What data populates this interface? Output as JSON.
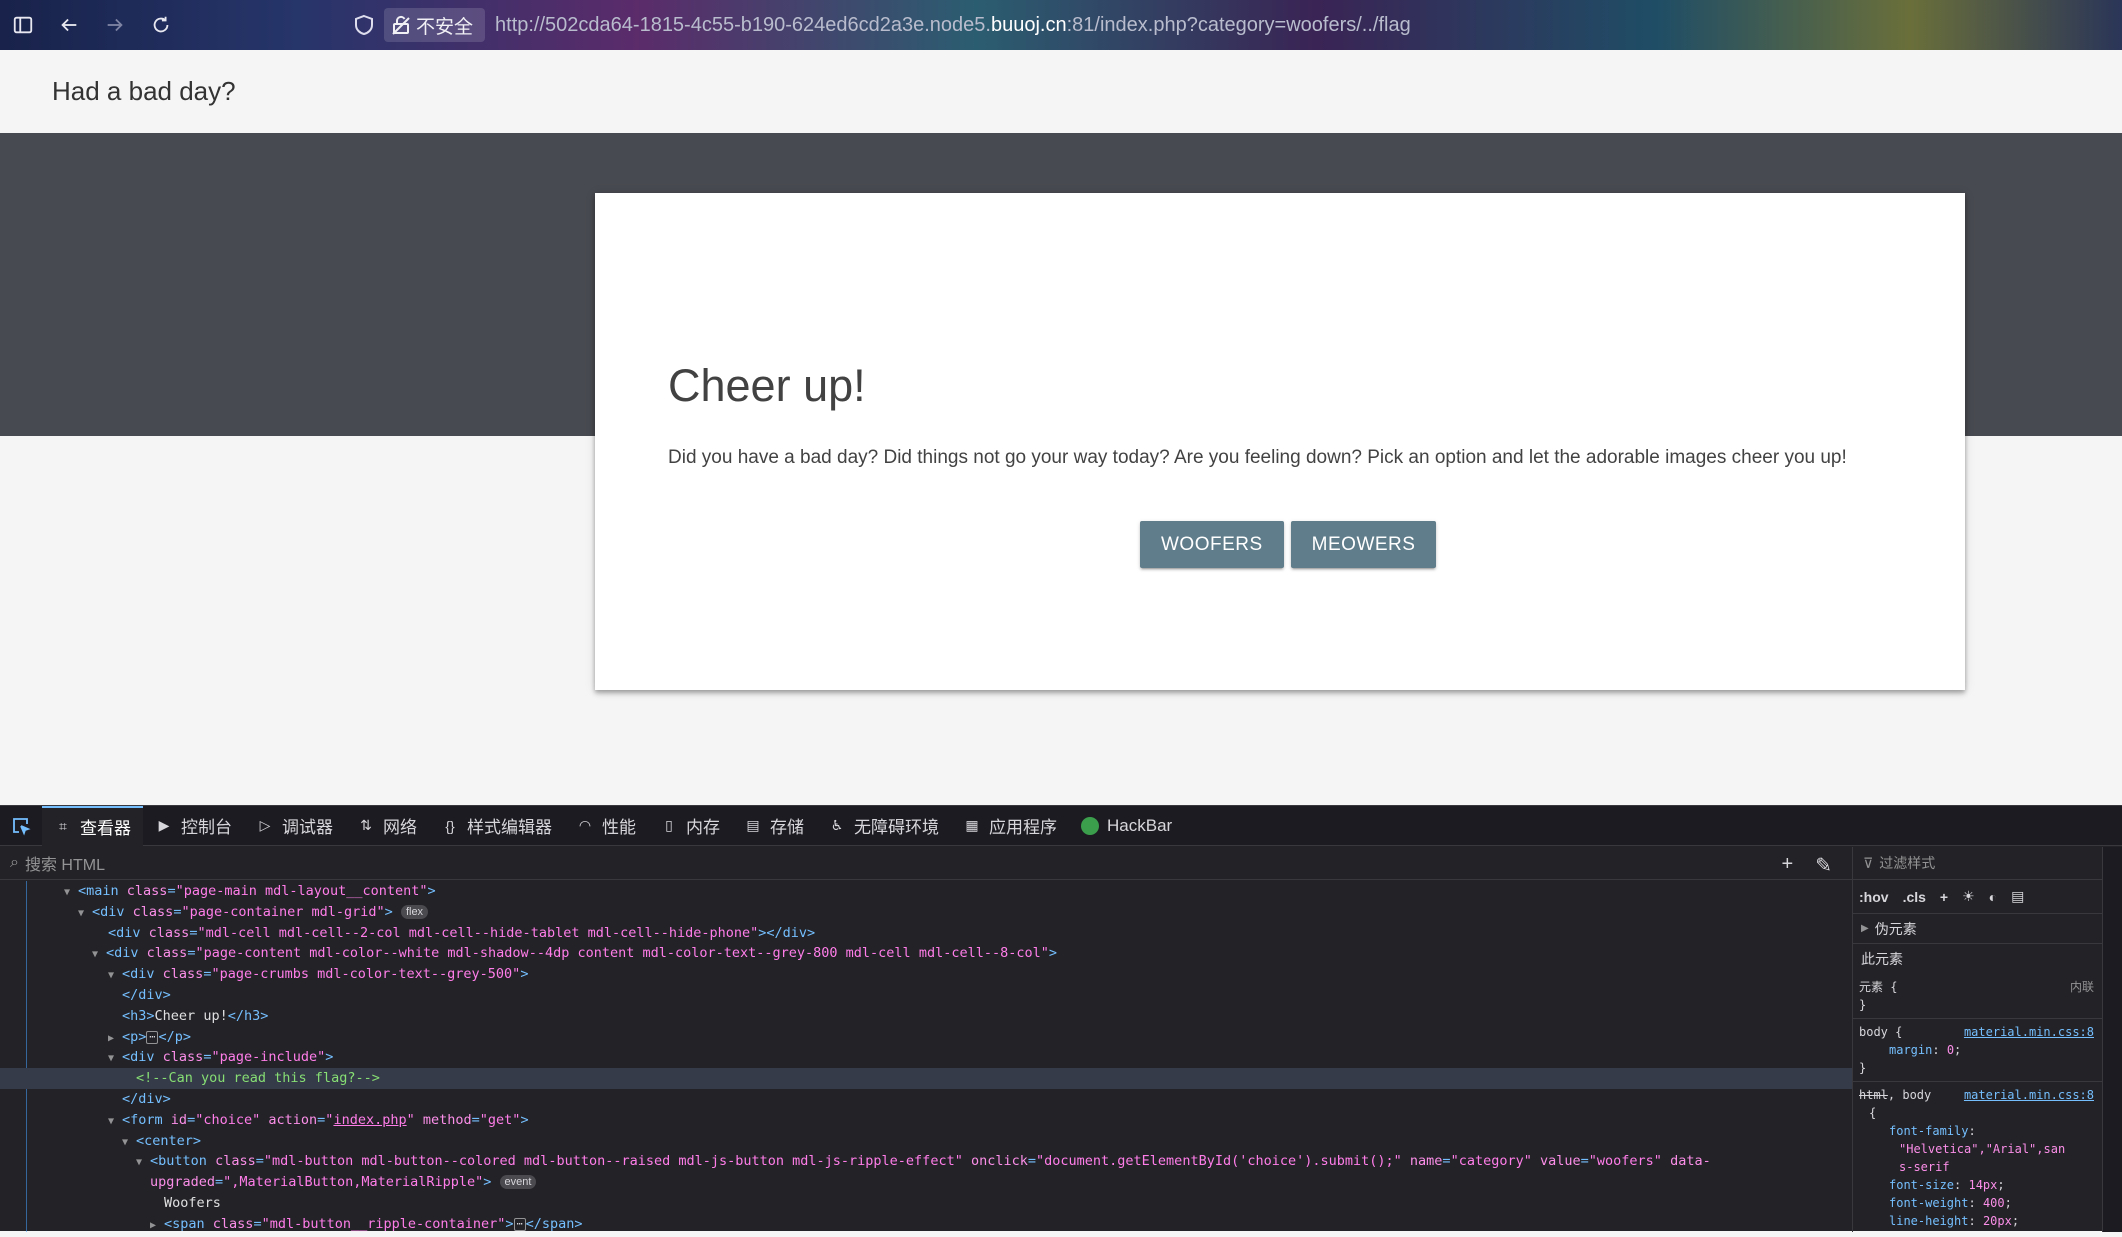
{
  "browser": {
    "security_label": "不安全",
    "url_prefix": "http://502cda64-1815-4c55-b190-624ed6cd2a3e.node5.",
    "url_domain": "buuoj.cn",
    "url_suffix": ":81/index.php?category=woofers/../flag"
  },
  "page": {
    "header_title": "Had a bad day?",
    "heading": "Cheer up!",
    "paragraph": "Did you have a bad day? Did things not go your way today? Are you feeling down? Pick an option and let the adorable images cheer you up!",
    "buttons": [
      "WOOFERS",
      "MEOWERS"
    ]
  },
  "devtools": {
    "tabs": [
      "查看器",
      "控制台",
      "调试器",
      "网络",
      "样式编辑器",
      "性能",
      "内存",
      "存储",
      "无障碍环境",
      "应用程序",
      "HackBar"
    ],
    "search_placeholder": "搜索 HTML",
    "tree": {
      "l1_a": "main",
      "l1_b": "class",
      "l1_c": "\"page-main mdl-layout__content\"",
      "l2_a": "div",
      "l2_b": "class",
      "l2_c": "\"page-container mdl-grid\"",
      "l2_badge": "flex",
      "l3_a": "div",
      "l3_b": "class",
      "l3_c": "\"mdl-cell mdl-cell--2-col mdl-cell--hide-tablet mdl-cell--hide-phone\"",
      "l3_d": "div",
      "l4_a": "div",
      "l4_b": "class",
      "l4_c": "\"page-content mdl-color--white mdl-shadow--4dp content mdl-color-text--grey-800 mdl-cell mdl-cell--8-col\"",
      "l5_a": "div",
      "l5_b": "class",
      "l5_c": "\"page-crumbs mdl-color-text--grey-500\"",
      "l6_a": "div",
      "l7_a": "h3",
      "l7_text": "Cheer up!",
      "l7_b": "h3",
      "l8_a": "p",
      "l8_b": "p",
      "l9_a": "div",
      "l9_b": "class",
      "l9_c": "\"page-include\"",
      "l10_comment": "<!--Can you read this flag?-->",
      "l11_a": "div",
      "l12_a": "form",
      "l12_b": "id",
      "l12_c": "\"choice\"",
      "l12_d": "action",
      "l12_e1": "\"",
      "l12_e2": "index.php",
      "l12_e3": "\"",
      "l12_f": "method",
      "l12_g": "\"get\"",
      "l13_a": "center",
      "l14_a": "button",
      "l14_b": "class",
      "l14_c": "\"mdl-button mdl-button--colored mdl-button--raised mdl-js-button mdl-js-ripple-effect\"",
      "l14_d": "onclick",
      "l14_e": "\"document.getElementById('choice').submit();\"",
      "l14_f": "name",
      "l14_g": "\"category\"",
      "l14_h": "value",
      "l14_i": "\"woofers\"",
      "l14_j": "data-",
      "l15_a": "upgraded",
      "l15_b": "\",MaterialButton,MaterialRipple\"",
      "l15_badge": "event",
      "l16_text": "Woofers",
      "l17_a": "span",
      "l17_b": "class",
      "l17_c": "\"mdl-button__ripple-container\"",
      "l17_d": "span"
    },
    "rules": {
      "filter_placeholder": "过滤样式",
      "hov": ":hov",
      "cls": ".cls",
      "pseudo_label": "伪元素",
      "this_element": "此元素",
      "element_rule": "元素",
      "inline_label": "内联",
      "brace_open": "{",
      "brace_close": "}",
      "body_selector": "body",
      "body_source": "material.min.css:8",
      "margin_prop": "margin",
      "margin_val": "0",
      "html_selector_struck": "html",
      "html_selector_rest": ", body",
      "html_source": "material.min.css:8",
      "ff_prop": "font-family",
      "ff_val_1": "\"Helvetica\",\"Arial\",san",
      "ff_val_2": "s-serif",
      "fs_prop": "font-size",
      "fs_val": "14px",
      "fw_prop": "font-weight",
      "fw_val": "400",
      "lh_prop": "line-height",
      "lh_val": "20px"
    }
  }
}
